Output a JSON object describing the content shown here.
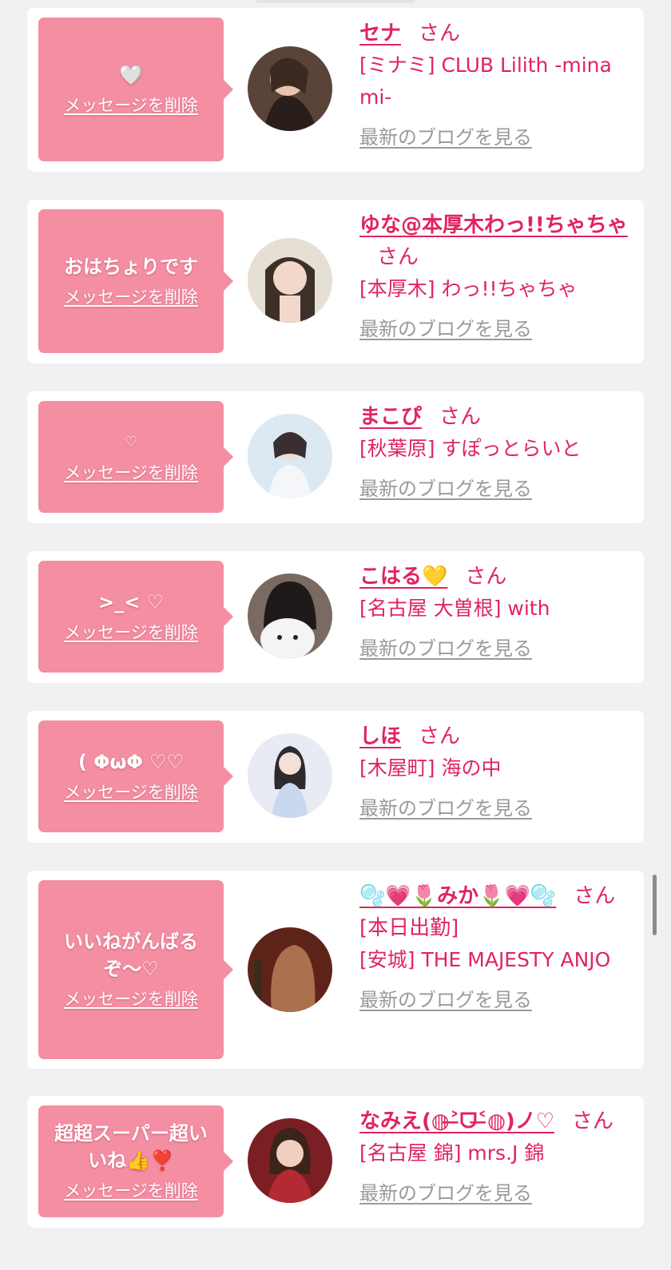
{
  "delete_label": "メッセージを削除",
  "blog_label": "最新のブログを見る",
  "san_label": "さん",
  "colors": {
    "accent": "#e0245e",
    "bubble": "#f48ea2",
    "link_gray": "#9a9a9a"
  },
  "cards": [
    {
      "message": "🤍",
      "name": "セナ",
      "name_suffix": "",
      "shop": "[ミナミ] CLUB Lilith -minami-"
    },
    {
      "message": "おはちょりです",
      "name": "ゆな@本厚木わっ!!ちゃちゃ",
      "name_suffix": "",
      "shop": "[本厚木] わっ!!ちゃちゃ"
    },
    {
      "message": "♡",
      "name": "まこぴ",
      "name_suffix": "",
      "shop": "[秋葉原] すぽっとらいと"
    },
    {
      "message": ">_< ♡",
      "name": "こはる💛",
      "name_suffix": "",
      "shop": "[名古屋 大曽根] with"
    },
    {
      "message": "( ΦωΦ ♡♡",
      "name": "しほ",
      "name_suffix": "",
      "shop": "[木屋町] 海の中"
    },
    {
      "message": "いいねがんばるぞ〜♡",
      "name": "🫧💗🌷みか🌷💗🫧",
      "name_suffix": "[本日出勤]",
      "shop": "[安城] THE MAJESTY ANJO"
    },
    {
      "message": "超超スーパー超いいね👍❣️",
      "name": "なみえ(◍˃̶ᗜ˂̶◍)ノ♡",
      "name_suffix": "",
      "shop": "[名古屋 錦] mrs.J 錦"
    }
  ]
}
